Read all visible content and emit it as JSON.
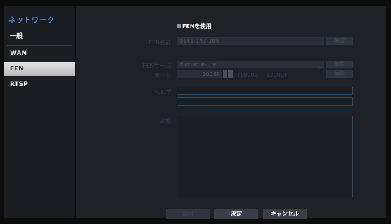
{
  "sidebar": {
    "title": "ネットワーク",
    "items": [
      {
        "label": "一般"
      },
      {
        "label": "WAN"
      },
      {
        "label": "FEN"
      },
      {
        "label": "RTSP"
      }
    ]
  },
  "fen": {
    "enable_label": "FENを使用",
    "fen_name_label": "FEN名前",
    "fen_name_value": "0141-143-206",
    "check_button": "確認",
    "fen_server_label": "FENサーバ",
    "fen_server_value": "dvrnames.net",
    "server_edit_button": "編集",
    "port_label": "ポート",
    "port_value": "10088",
    "port_range": "(10000 ~ 12000)",
    "port_edit_button": "編集",
    "help_label": "ヘルプ",
    "status_label": "状態"
  },
  "footer": {
    "apply": "適用",
    "ok": "決定",
    "cancel": "キャンセル"
  },
  "colors": {
    "accent_title": "#4a8cd8",
    "field_border": "#2a4a66",
    "active_item": "#d0d0d0"
  }
}
